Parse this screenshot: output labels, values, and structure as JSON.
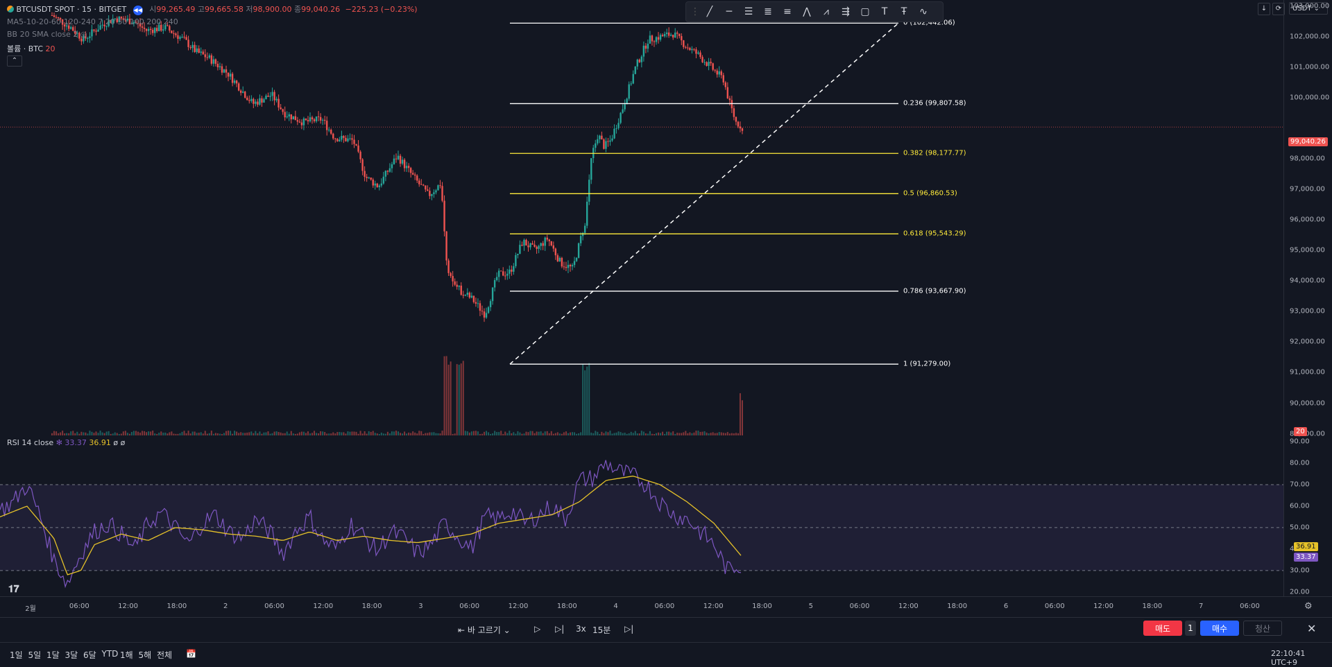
{
  "symbol": {
    "title": "BTCUSDT SPOT · 15 · BITGET",
    "o_label": "시",
    "o": "99,265.49",
    "h_label": "고",
    "h": "99,665.58",
    "l_label": "저",
    "l": "98,900.00",
    "c_label": "종",
    "c": "99,040.26",
    "change": "−225.23 (−0.23%)"
  },
  "indicators": {
    "ma": "MA5-10-20-60-120-240 7 20 50 100 200 240",
    "bb": "BB 20 SMA close 2",
    "volume_label": "볼륨 · BTC",
    "volume_value": "20"
  },
  "rsi_legend": {
    "label": "RSI 14 close",
    "rsi": "33.37",
    "ma": "36.91",
    "extra": "ø ø"
  },
  "top_right": {
    "currency": "USDT"
  },
  "price_axis": {
    "ticks": [
      {
        "v": 103000,
        "t": "103,000.00"
      },
      {
        "v": 102000,
        "t": "102,000.00"
      },
      {
        "v": 101000,
        "t": "101,000.00"
      },
      {
        "v": 100000,
        "t": "100,000.00"
      },
      {
        "v": 98000,
        "t": "98,000.00"
      },
      {
        "v": 97000,
        "t": "97,000.00"
      },
      {
        "v": 96000,
        "t": "96,000.00"
      },
      {
        "v": 95000,
        "t": "95,000.00"
      },
      {
        "v": 94000,
        "t": "94,000.00"
      },
      {
        "v": 93000,
        "t": "93,000.00"
      },
      {
        "v": 92000,
        "t": "92,000.00"
      },
      {
        "v": 91000,
        "t": "91,000.00"
      },
      {
        "v": 90000,
        "t": "90,000.00"
      },
      {
        "v": 89000,
        "t": "89,000.00"
      }
    ],
    "last_price": "99,040.26",
    "volume_badge": "20"
  },
  "rsi_axis": {
    "ticks": [
      {
        "v": 90,
        "t": "90.00"
      },
      {
        "v": 80,
        "t": "80.00"
      },
      {
        "v": 70,
        "t": "70.00"
      },
      {
        "v": 60,
        "t": "60.00"
      },
      {
        "v": 50,
        "t": "50.00"
      },
      {
        "v": 40,
        "t": "40.00"
      },
      {
        "v": 30,
        "t": "30.00"
      },
      {
        "v": 20,
        "t": "20.00"
      }
    ],
    "rsi_badge": "33.37",
    "ma_badge": "36.91"
  },
  "fib_levels": [
    {
      "ratio": "0",
      "price": 102442.06,
      "label": "0 (102,442.06)",
      "color": "#ffffff"
    },
    {
      "ratio": "0.236",
      "price": 99807.58,
      "label": "0.236 (99,807.58)",
      "color": "#ffffff"
    },
    {
      "ratio": "0.382",
      "price": 98177.77,
      "label": "0.382 (98,177.77)",
      "color": "#ffeb3b"
    },
    {
      "ratio": "0.5",
      "price": 96860.53,
      "label": "0.5 (96,860.53)",
      "color": "#ffeb3b"
    },
    {
      "ratio": "0.618",
      "price": 95543.29,
      "label": "0.618 (95,543.29)",
      "color": "#ffeb3b"
    },
    {
      "ratio": "0.786",
      "price": 93667.9,
      "label": "0.786 (93,667.90)",
      "color": "#ffffff"
    },
    {
      "ratio": "1",
      "price": 91279.0,
      "label": "1 (91,279.00)",
      "color": "#ffffff"
    }
  ],
  "time_axis": {
    "ticks": [
      "2월",
      "06:00",
      "12:00",
      "18:00",
      "2",
      "06:00",
      "12:00",
      "18:00",
      "3",
      "06:00",
      "12:00",
      "18:00",
      "4",
      "06:00",
      "12:00",
      "18:00",
      "5",
      "06:00",
      "12:00",
      "18:00",
      "6",
      "06:00",
      "12:00",
      "18:00",
      "7",
      "06:00"
    ]
  },
  "replay": {
    "select_bar": "바 고르기",
    "speed": "3x",
    "interval": "15분"
  },
  "periods": [
    "1일",
    "5일",
    "1달",
    "3달",
    "6달",
    "YTD",
    "1해",
    "5해",
    "전체"
  ],
  "trade": {
    "sell": "매도",
    "qty": "1",
    "buy": "매수",
    "close": "청산"
  },
  "clock": "22:10:41 UTC+9",
  "colors": {
    "up": "#26a69a",
    "down": "#ef5350",
    "rsi": "#7e57c2",
    "rsi_ma": "#e6c229",
    "bg": "#131722"
  },
  "chart_data": {
    "type": "candlestick",
    "price_range": [
      88900,
      103200
    ],
    "rsi_range": [
      18,
      91
    ],
    "description_points": {
      "price_path": [
        [
          0,
          102700
        ],
        [
          3,
          102300
        ],
        [
          5,
          101900
        ],
        [
          8,
          102400
        ],
        [
          10,
          102600
        ],
        [
          13,
          102500
        ],
        [
          15,
          102200
        ],
        [
          18,
          102300
        ],
        [
          21,
          101900
        ],
        [
          23,
          101500
        ],
        [
          25,
          101300
        ],
        [
          28,
          100800
        ],
        [
          30,
          100300
        ],
        [
          32,
          99800
        ],
        [
          35,
          100100
        ],
        [
          37,
          99500
        ],
        [
          40,
          99200
        ],
        [
          43,
          99300
        ],
        [
          45,
          98700
        ],
        [
          48,
          98600
        ],
        [
          50,
          97400
        ],
        [
          52,
          97100
        ],
        [
          55,
          98100
        ],
        [
          58,
          97300
        ],
        [
          60,
          96800
        ],
        [
          62,
          97200
        ],
        [
          63,
          94200
        ],
        [
          65,
          93700
        ],
        [
          67,
          93400
        ],
        [
          69,
          92900
        ],
        [
          71,
          94200
        ],
        [
          73,
          94300
        ],
        [
          75,
          95300
        ],
        [
          77,
          95000
        ],
        [
          79,
          95400
        ],
        [
          81,
          94600
        ],
        [
          83,
          94400
        ],
        [
          85,
          96000
        ],
        [
          86,
          98100
        ],
        [
          87,
          98800
        ],
        [
          88,
          98400
        ],
        [
          89,
          98600
        ],
        [
          91,
          99700
        ],
        [
          93,
          101000
        ],
        [
          95,
          101900
        ],
        [
          97,
          102000
        ],
        [
          99,
          102100
        ],
        [
          101,
          101700
        ],
        [
          103,
          101400
        ],
        [
          105,
          101000
        ],
        [
          107,
          100600
        ],
        [
          108,
          99800
        ],
        [
          109,
          99200
        ],
        [
          110,
          99040
        ]
      ],
      "volume_spikes": [
        [
          63,
          20
        ],
        [
          65,
          18
        ],
        [
          85,
          18
        ],
        [
          110,
          10
        ]
      ],
      "rsi_path": [
        [
          0,
          58
        ],
        [
          2,
          62
        ],
        [
          4,
          70
        ],
        [
          6,
          55
        ],
        [
          8,
          35
        ],
        [
          10,
          24
        ],
        [
          12,
          38
        ],
        [
          14,
          48
        ],
        [
          16,
          52
        ],
        [
          18,
          47
        ],
        [
          20,
          40
        ],
        [
          22,
          52
        ],
        [
          24,
          57
        ],
        [
          26,
          50
        ],
        [
          28,
          42
        ],
        [
          30,
          52
        ],
        [
          32,
          56
        ],
        [
          34,
          48
        ],
        [
          36,
          45
        ],
        [
          38,
          54
        ],
        [
          40,
          48
        ],
        [
          42,
          38
        ],
        [
          44,
          49
        ],
        [
          46,
          55
        ],
        [
          48,
          44
        ],
        [
          50,
          40
        ],
        [
          52,
          52
        ],
        [
          54,
          46
        ],
        [
          56,
          39
        ],
        [
          58,
          48
        ],
        [
          60,
          45
        ],
        [
          62,
          38
        ],
        [
          64,
          42
        ],
        [
          66,
          52
        ],
        [
          68,
          46
        ],
        [
          70,
          40
        ],
        [
          72,
          55
        ],
        [
          74,
          54
        ],
        [
          76,
          58
        ],
        [
          78,
          52
        ],
        [
          80,
          56
        ],
        [
          82,
          60
        ],
        [
          84,
          54
        ],
        [
          86,
          72
        ],
        [
          88,
          73
        ],
        [
          90,
          80
        ],
        [
          92,
          76
        ],
        [
          94,
          74
        ],
        [
          96,
          70
        ],
        [
          98,
          62
        ],
        [
          100,
          56
        ],
        [
          102,
          54
        ],
        [
          104,
          48
        ],
        [
          106,
          42
        ],
        [
          108,
          30
        ],
        [
          110,
          33
        ]
      ],
      "rsi_ma_path": [
        [
          0,
          55
        ],
        [
          4,
          60
        ],
        [
          8,
          45
        ],
        [
          10,
          28
        ],
        [
          12,
          30
        ],
        [
          14,
          42
        ],
        [
          18,
          47
        ],
        [
          22,
          44
        ],
        [
          26,
          50
        ],
        [
          30,
          49
        ],
        [
          34,
          47
        ],
        [
          38,
          46
        ],
        [
          42,
          44
        ],
        [
          46,
          48
        ],
        [
          50,
          44
        ],
        [
          54,
          46
        ],
        [
          58,
          44
        ],
        [
          62,
          43
        ],
        [
          66,
          45
        ],
        [
          70,
          47
        ],
        [
          74,
          52
        ],
        [
          78,
          54
        ],
        [
          82,
          56
        ],
        [
          86,
          62
        ],
        [
          90,
          72
        ],
        [
          94,
          74
        ],
        [
          98,
          70
        ],
        [
          102,
          62
        ],
        [
          106,
          52
        ],
        [
          110,
          37
        ]
      ]
    }
  }
}
